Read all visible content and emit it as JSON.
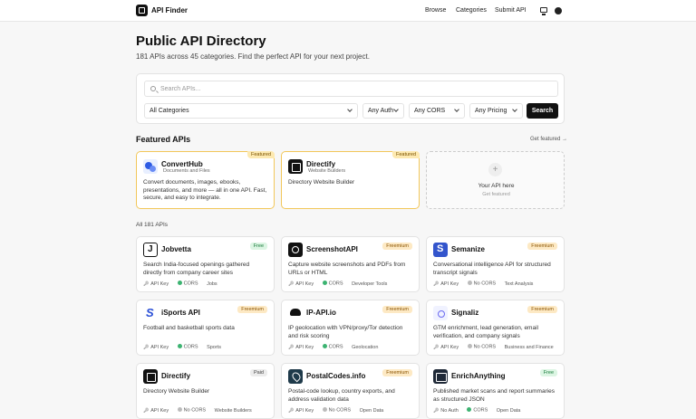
{
  "header": {
    "brand": "API Finder",
    "nav": {
      "browse": "Browse",
      "categories": "Categories",
      "submit": "Submit API"
    },
    "icons": [
      "monitor-icon",
      "github-icon"
    ]
  },
  "hero": {
    "title": "Public API Directory",
    "subtitle": "181 APIs across 45 categories. Find the perfect API for your next project."
  },
  "search": {
    "placeholder": "Search APIs...",
    "category": "All Categories",
    "auth": "Any Auth",
    "cors": "Any CORS",
    "pricing": "Any Pricing",
    "button": "Search"
  },
  "featured": {
    "title": "Featured APIs",
    "link": "Get featured →",
    "badge": "Featured",
    "items": [
      {
        "name": "ConvertHub",
        "category": "Documents and Files",
        "description_1": "Convert documents, images, ebooks,",
        "description_2": "presentations, and more — all in one API. Fast,",
        "description_3": "secure, and easy to integrate."
      },
      {
        "name": "Directify",
        "category": "Website Builders",
        "description_1": "Directory Website Builder"
      }
    ],
    "placeholder": {
      "title": "Your API here",
      "sub": "Get featured"
    }
  },
  "all": {
    "title": "All 181 APIs",
    "items": [
      {
        "name": "Jobvetta",
        "pricing": "Free",
        "d1": "Search India-focused openings gathered",
        "d2": "directly from company career sites",
        "auth": "API Key",
        "cors": "CORS",
        "category": "Jobs"
      },
      {
        "name": "ScreenshotAPI",
        "pricing": "Freemium",
        "d1": "Capture website screenshots and PDFs from",
        "d2": "URLs or HTML",
        "auth": "API Key",
        "cors": "CORS",
        "category": "Developer Tools"
      },
      {
        "name": "Semanize",
        "pricing": "Freemium",
        "d1": "Conversational intelligence API for structured",
        "d2": "transcript signals",
        "auth": "API Key",
        "cors": "No CORS",
        "category": "Text Analysis"
      },
      {
        "name": "iSports API",
        "pricing": "Freemium",
        "d1": "Football and basketball sports data",
        "d2": "",
        "auth": "API Key",
        "cors": "CORS",
        "category": "Sports"
      },
      {
        "name": "IP-API.io",
        "pricing": "Freemium",
        "d1": "IP geolocation with VPN/proxy/Tor detection",
        "d2": "and risk scoring",
        "auth": "API Key",
        "cors": "CORS",
        "category": "Geolocation"
      },
      {
        "name": "Signaliz",
        "pricing": "Freemium",
        "d1": "GTM enrichment, lead generation, email",
        "d2": "verification, and company signals",
        "auth": "API Key",
        "cors": "No CORS",
        "category": "Business and Finance"
      },
      {
        "name": "Directify",
        "pricing": "Paid",
        "d1": "Directory Website Builder",
        "d2": "",
        "auth": "API Key",
        "cors": "No CORS",
        "category": "Website Builders"
      },
      {
        "name": "PostalCodes.info",
        "pricing": "Freemium",
        "d1": "Postal-code lookup, country exports, and",
        "d2": "address validation data",
        "auth": "API Key",
        "cors": "No CORS",
        "category": "Open Data"
      },
      {
        "name": "EnrichAnything",
        "pricing": "Free",
        "d1": "Published market scans and report summaries",
        "d2": "as structured JSON",
        "auth": "No Auth",
        "cors": "CORS",
        "category": "Open Data"
      }
    ]
  }
}
